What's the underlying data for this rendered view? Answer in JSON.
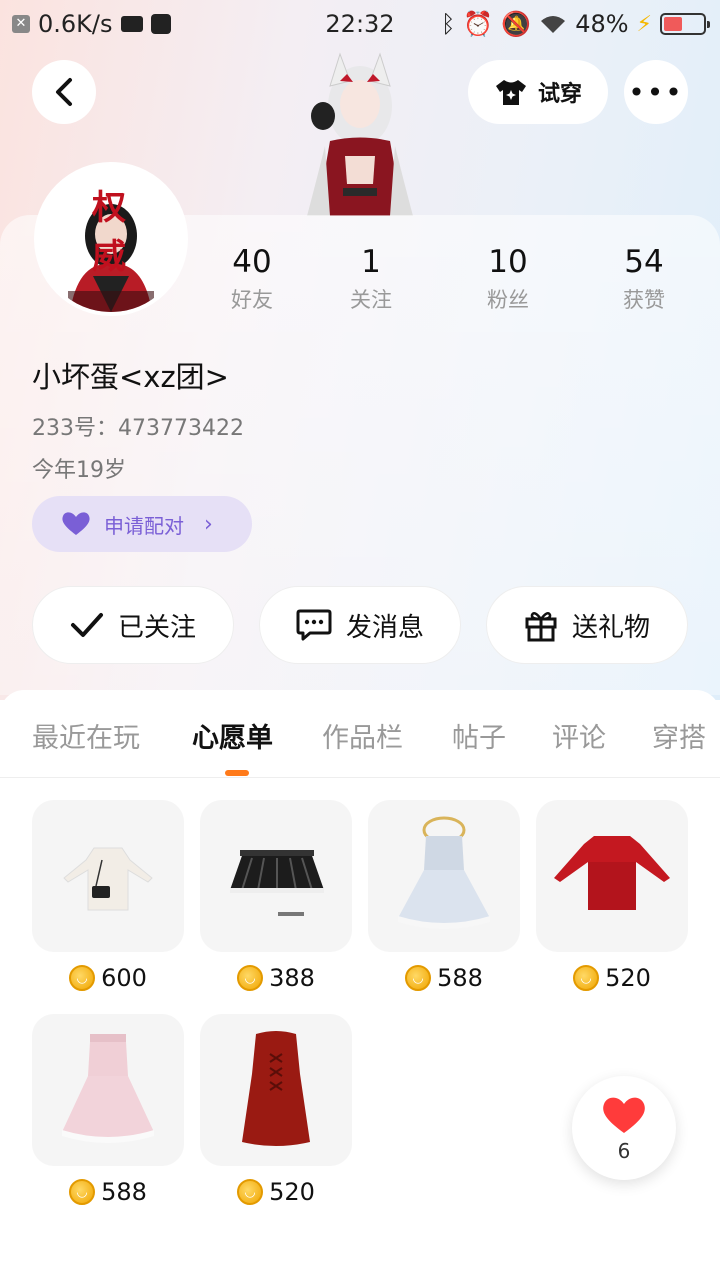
{
  "status_bar": {
    "speed": "0.6K/s",
    "time": "22:32",
    "battery": "48%",
    "battery_level": 0.48
  },
  "header": {
    "try_on_label": "试穿",
    "more_label": "•••"
  },
  "profile": {
    "username": "小坏蛋<xz团>",
    "id_line": "233号：473773422",
    "age_line": "今年19岁",
    "pair_label": "申请配对",
    "avatar_text": "权威",
    "stats": [
      {
        "value": "40",
        "label": "好友"
      },
      {
        "value": "1",
        "label": "关注"
      },
      {
        "value": "10",
        "label": "粉丝"
      },
      {
        "value": "54",
        "label": "获赞"
      }
    ]
  },
  "actions": {
    "follow_label": "已关注",
    "message_label": "发消息",
    "gift_label": "送礼物"
  },
  "tabs": [
    "最近在玩",
    "心愿单",
    "作品栏",
    "帖子",
    "评论",
    "穿搭"
  ],
  "active_tab": "心愿单",
  "wishlist": [
    {
      "price": "600",
      "item": "white-outfit"
    },
    {
      "price": "388",
      "item": "black-pleated-skirt"
    },
    {
      "price": "588",
      "item": "white-dress"
    },
    {
      "price": "520",
      "item": "red-dress"
    },
    {
      "price": "588",
      "item": "pink-dress"
    },
    {
      "price": "520",
      "item": "red-leather-dress"
    }
  ],
  "favorites": {
    "count": "6"
  },
  "colors": {
    "accent": "#ff7a1a",
    "pair_bg": "#e6e0f6",
    "pair_text": "#7a5fd6",
    "heart": "#ff3b3b"
  }
}
